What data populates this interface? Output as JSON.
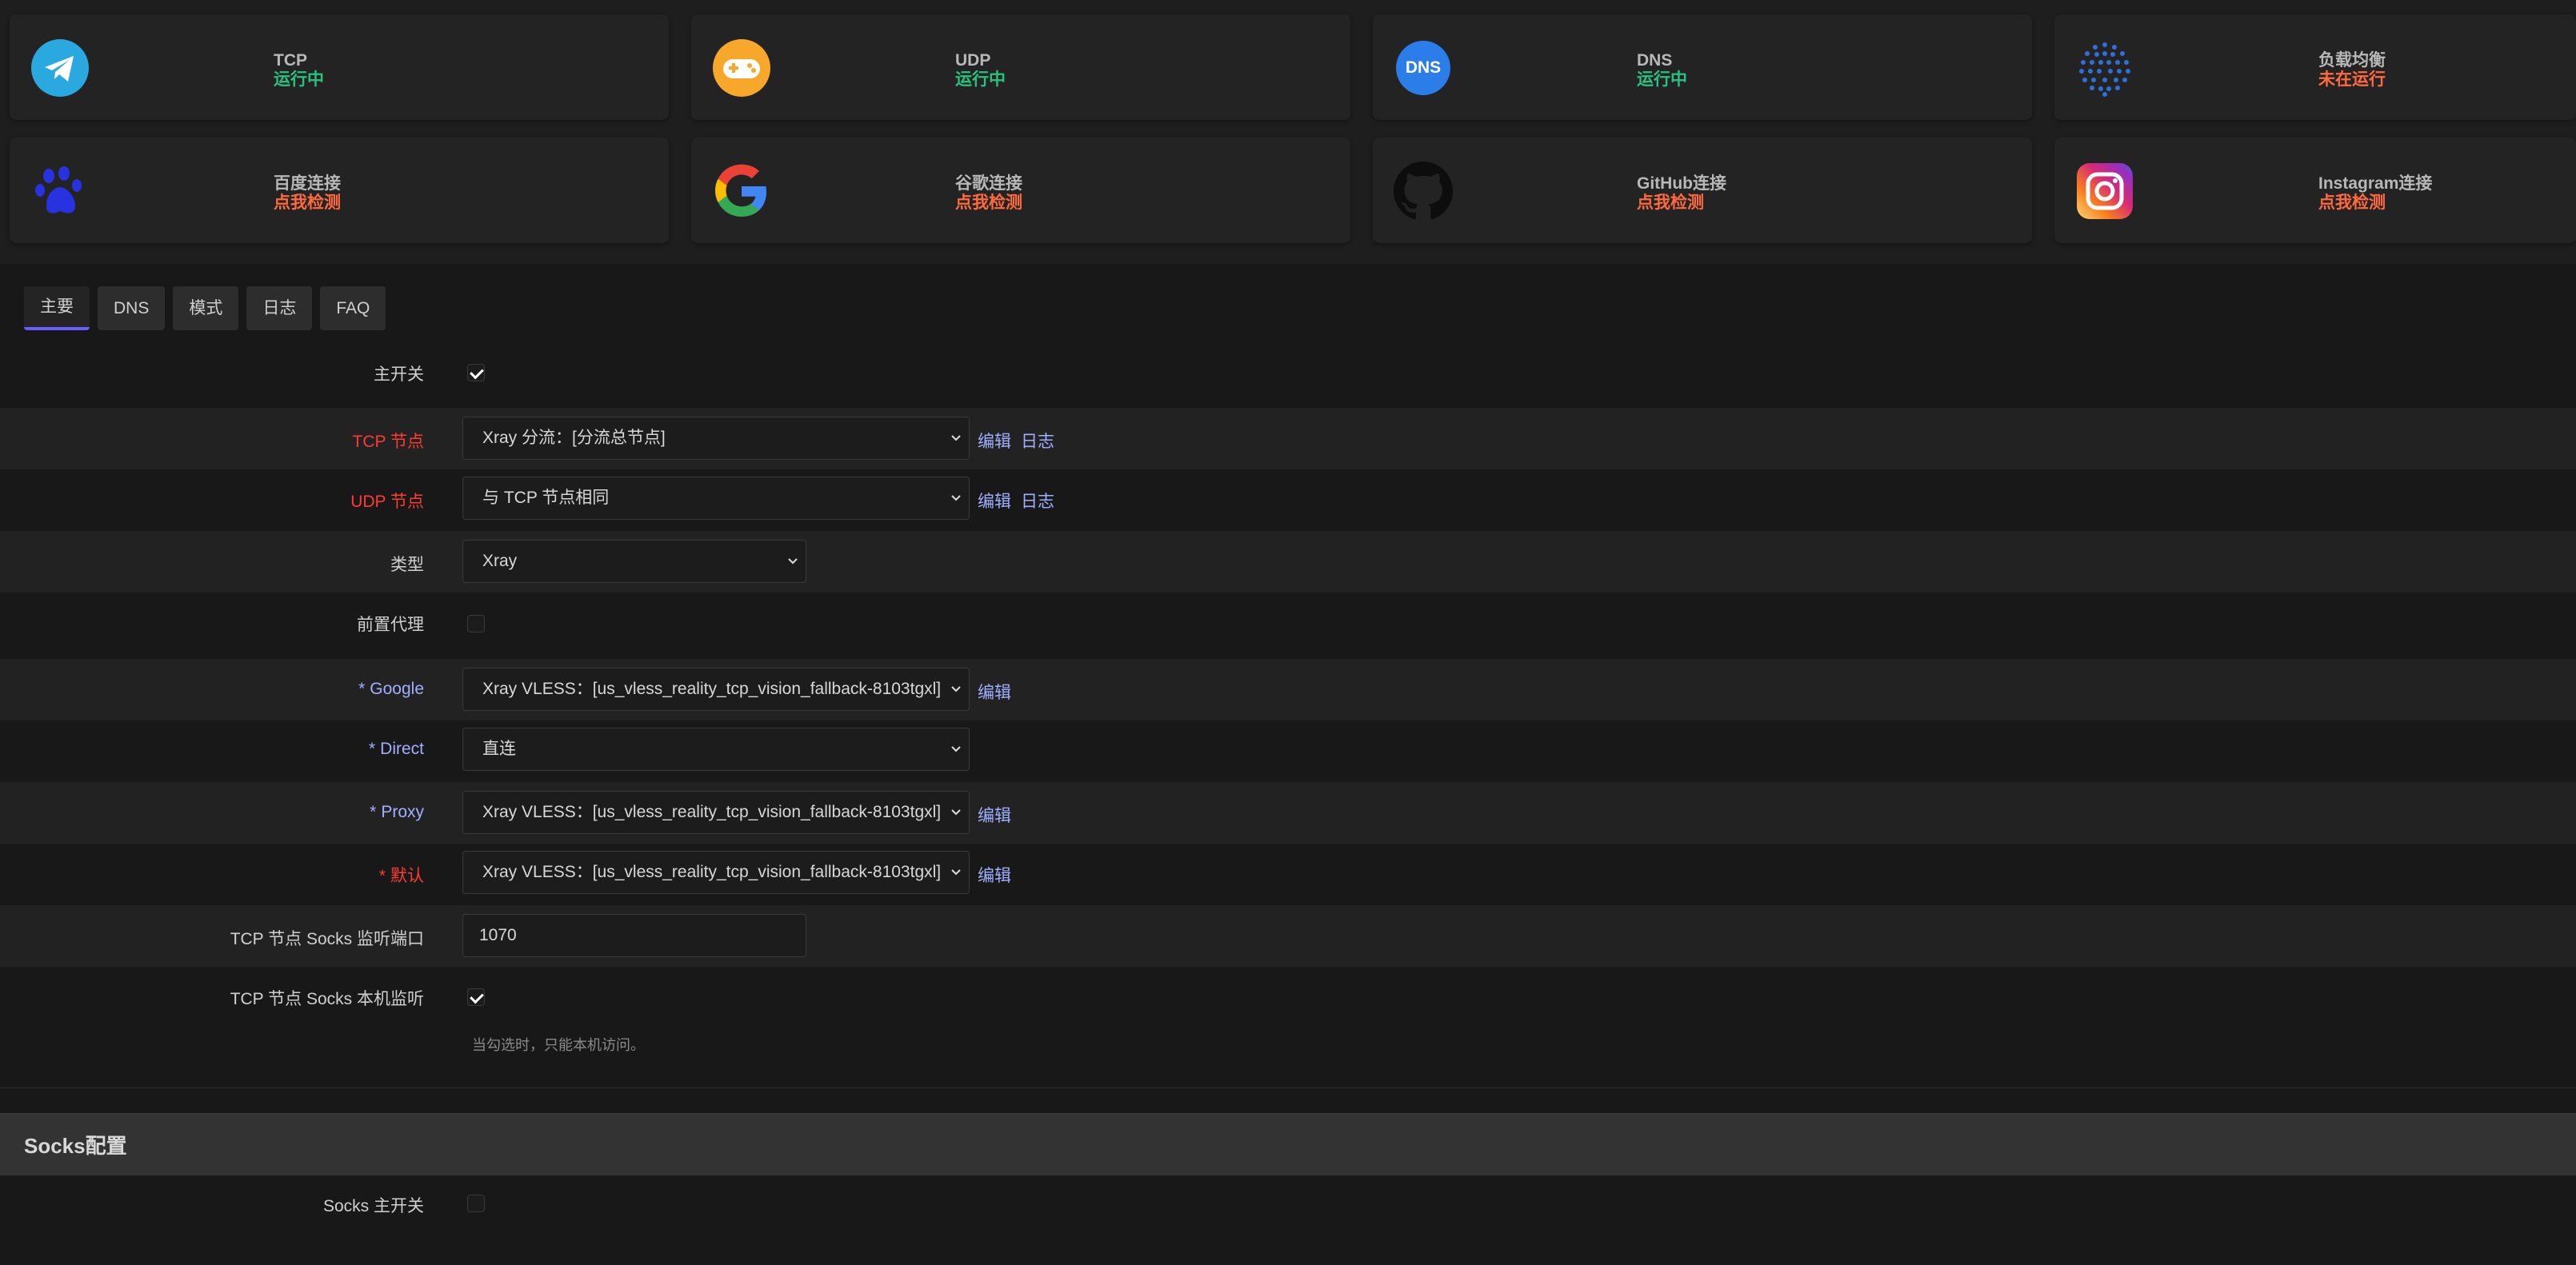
{
  "cards": [
    {
      "name": "TCP",
      "status": "运行中",
      "state": "ok",
      "icon": "telegram-icon"
    },
    {
      "name": "UDP",
      "status": "运行中",
      "state": "ok",
      "icon": "gamepad-icon"
    },
    {
      "name": "DNS",
      "status": "运行中",
      "state": "ok",
      "icon": "dns-icon"
    },
    {
      "name": "负载均衡",
      "status": "未在运行",
      "state": "bad",
      "icon": "globe-dots-icon"
    },
    {
      "name": "百度连接",
      "status": "点我检测",
      "state": "warn",
      "icon": "baidu-paw-icon"
    },
    {
      "name": "谷歌连接",
      "status": "点我检测",
      "state": "warn",
      "icon": "google-icon"
    },
    {
      "name": "GitHub连接",
      "status": "点我检测",
      "state": "warn",
      "icon": "github-icon"
    },
    {
      "name": "Instagram连接",
      "status": "点我检测",
      "state": "warn",
      "icon": "instagram-icon"
    }
  ],
  "dns_icon_text": "DNS",
  "tabs": [
    "主要",
    "DNS",
    "模式",
    "日志",
    "FAQ"
  ],
  "form": {
    "main_switch_label": "主开关",
    "tcp_node_label": "TCP 节点",
    "tcp_node_value": "Xray 分流：[分流总节点]",
    "udp_node_label": "UDP 节点",
    "udp_node_value": "与 TCP 节点相同",
    "type_label": "类型",
    "type_value": "Xray",
    "pre_proxy_label": "前置代理",
    "google_label": "Google",
    "google_value": "Xray VLESS：[us_vless_reality_tcp_vision_fallback-8103tgxl]",
    "direct_label": "Direct",
    "direct_value": "直连",
    "proxy_label": "Proxy",
    "proxy_value": "Xray VLESS：[us_vless_reality_tcp_vision_fallback-8103tgxl]",
    "default_label": "默认",
    "default_value": "Xray VLESS：[us_vless_reality_tcp_vision_fallback-8103tgxl]",
    "socks_port_label": "TCP 节点 Socks 监听端口",
    "socks_port_value": "1070",
    "socks_local_label": "TCP 节点 Socks 本机监听",
    "socks_local_hint": "当勾选时，只能本机访问。",
    "star": "*",
    "edit": "编辑",
    "log": "日志"
  },
  "socks_section": {
    "title": "Socks配置",
    "main_switch_label": "Socks 主开关"
  },
  "colors": {
    "ok": "#26c281",
    "warn": "#ff6a3d",
    "required_red": "#ff3b30",
    "required_blue": "#9fb0ff",
    "tab_accent": "#6b5cff"
  }
}
